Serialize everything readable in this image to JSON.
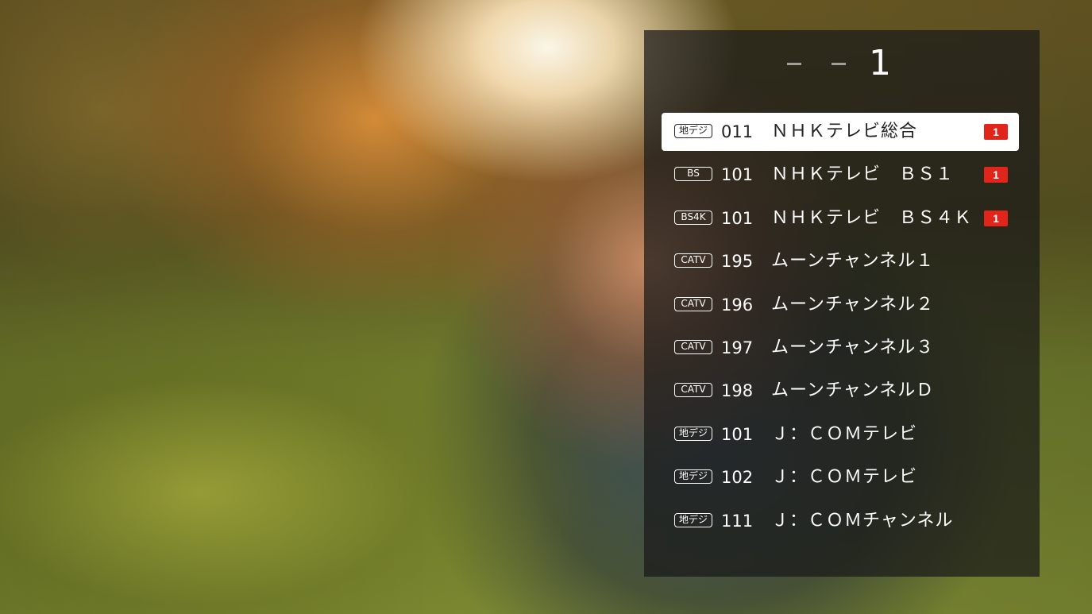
{
  "input": {
    "entered_digit": "1"
  },
  "channels": [
    {
      "type": "地デジ",
      "number": "011",
      "name": "ＮＨＫテレビ総合",
      "tag": "1",
      "selected": true
    },
    {
      "type": "BS",
      "number": "101",
      "name": "ＮＨＫテレビ　ＢＳ１",
      "tag": "1",
      "selected": false
    },
    {
      "type": "BS4K",
      "number": "101",
      "name": "ＮＨＫテレビ　ＢＳ４Ｋ",
      "tag": "1",
      "selected": false
    },
    {
      "type": "CATV",
      "number": "195",
      "name": "ムーンチャンネル１",
      "tag": "",
      "selected": false
    },
    {
      "type": "CATV",
      "number": "196",
      "name": "ムーンチャンネル２",
      "tag": "",
      "selected": false
    },
    {
      "type": "CATV",
      "number": "197",
      "name": "ムーンチャンネル３",
      "tag": "",
      "selected": false
    },
    {
      "type": "CATV",
      "number": "198",
      "name": "ムーンチャンネルＤ",
      "tag": "",
      "selected": false
    },
    {
      "type": "地デジ",
      "number": "101",
      "name": "Ｊ：ＣＯＭテレビ",
      "tag": "",
      "selected": false
    },
    {
      "type": "地デジ",
      "number": "102",
      "name": "Ｊ：ＣＯＭテレビ",
      "tag": "",
      "selected": false
    },
    {
      "type": "地デジ",
      "number": "111",
      "name": "Ｊ：ＣＯＭチャンネル",
      "tag": "",
      "selected": false
    }
  ],
  "colors": {
    "tag_red": "#e1251b",
    "panel": "#191919",
    "selected_row": "#ffffff"
  }
}
